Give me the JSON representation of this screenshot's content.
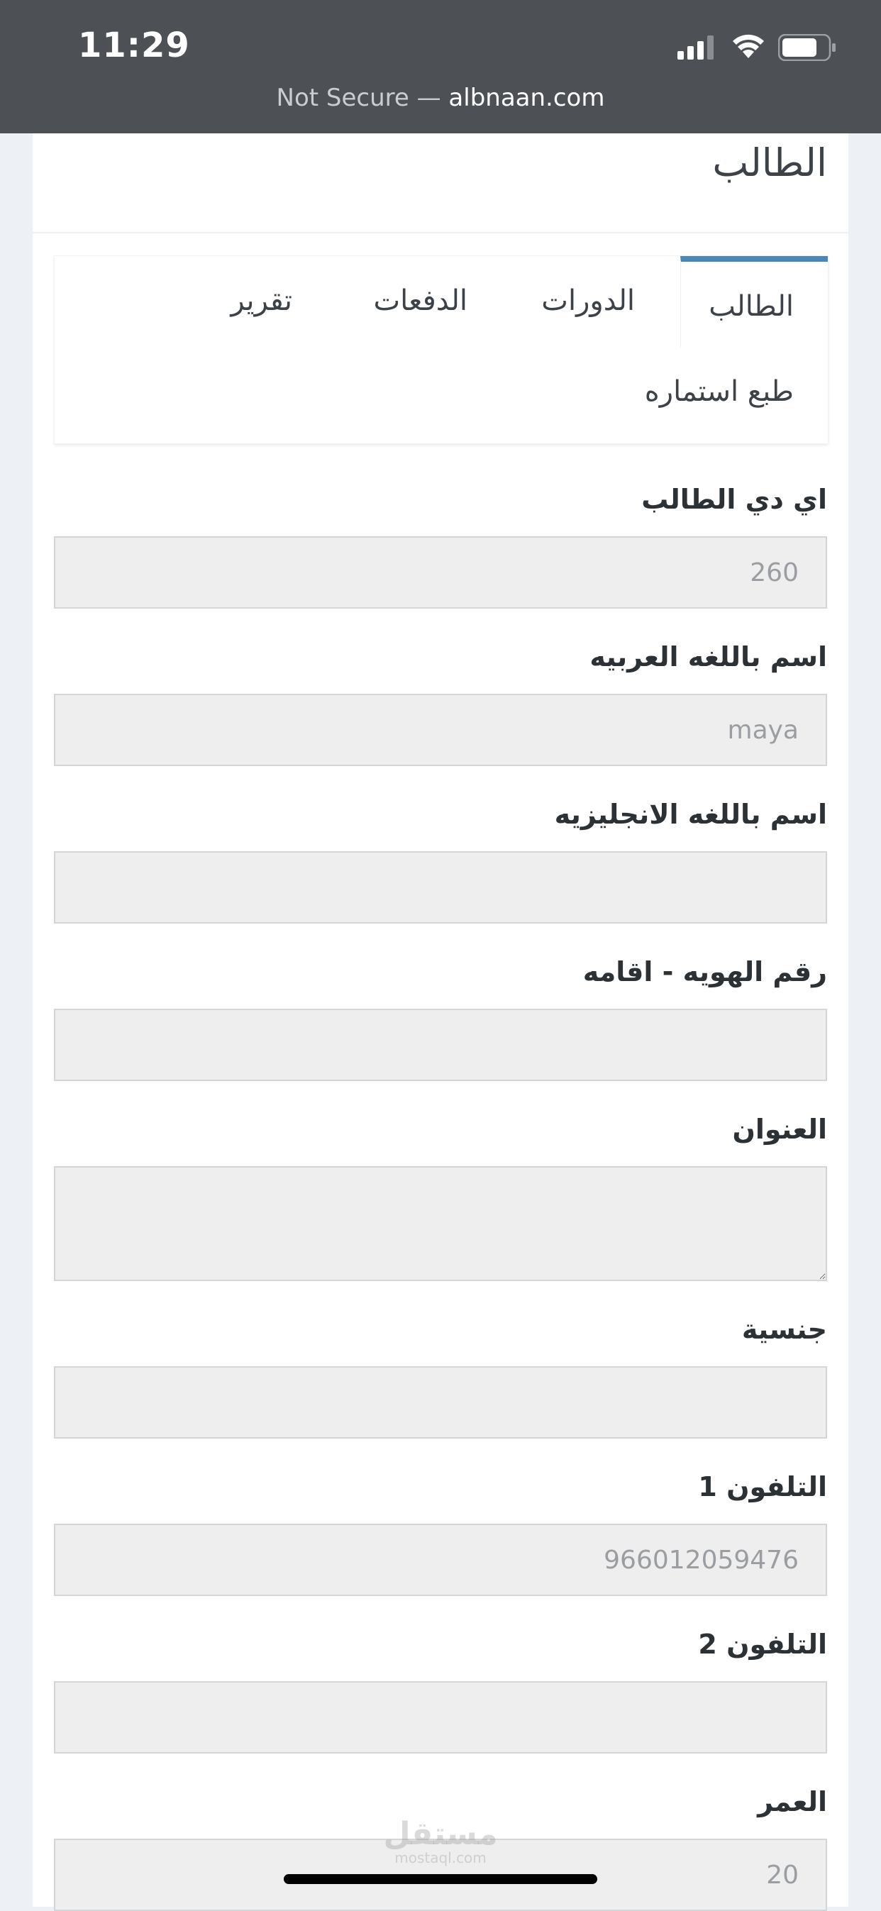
{
  "status_bar": {
    "time": "11:29",
    "url_prefix": "Not Secure — ",
    "url_domain": "albnaan.com",
    "icons": [
      "signal-icon",
      "wifi-icon",
      "battery-icon"
    ]
  },
  "page": {
    "title": "الطالب"
  },
  "tabs": {
    "active": "الطالب",
    "courses": "الدورات",
    "payments": "الدفعات",
    "report": "تقرير",
    "print_form": "طبع استماره"
  },
  "form": {
    "student_id": {
      "label": "اي دي الطالب",
      "value": "260"
    },
    "name_ar": {
      "label": "اسم باللغه العربيه",
      "value": "maya"
    },
    "name_en": {
      "label": "اسم باللغه الانجليزيه",
      "value": ""
    },
    "id_number": {
      "label": "رقم الهويه - اقامه",
      "value": ""
    },
    "address": {
      "label": "العنوان",
      "value": ""
    },
    "nationality": {
      "label": "جنسية",
      "value": ""
    },
    "phone1": {
      "label": "التلفون 1",
      "value": "966012059476"
    },
    "phone2": {
      "label": "التلفون 2",
      "value": ""
    },
    "age": {
      "label": "العمر",
      "value": "20"
    }
  },
  "watermark": {
    "arabic": "مستقل",
    "latin": "mostaql.com"
  },
  "colors": {
    "status_bar_bg": "#4d5155",
    "tab_accent": "#4a87b9",
    "field_bg": "#eeeeee",
    "page_bg": "#edf1f5"
  }
}
